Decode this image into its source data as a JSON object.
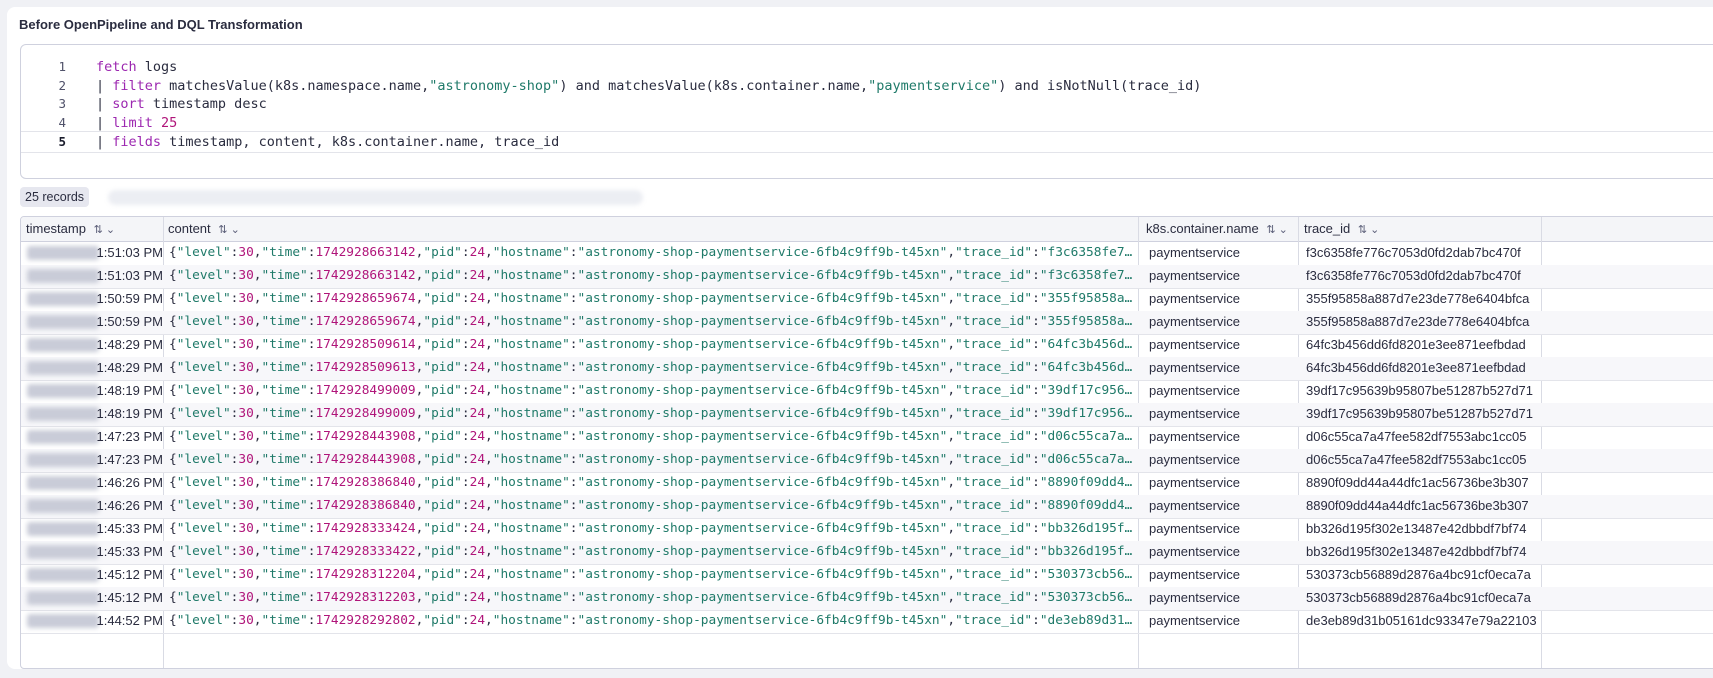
{
  "panel": {
    "title": "Before OpenPipeline and DQL Transformation"
  },
  "editor": {
    "lines": [
      {
        "num": "1",
        "segments": [
          [
            "kw",
            "fetch"
          ],
          [
            "plain",
            " logs"
          ]
        ]
      },
      {
        "num": "2",
        "segments": [
          [
            "plain",
            "| "
          ],
          [
            "kw",
            "filter"
          ],
          [
            "plain",
            " matchesValue(k8s.namespace.name,"
          ],
          [
            "str",
            "\"astronomy-shop\""
          ],
          [
            "plain",
            ") and matchesValue(k8s.container.name,"
          ],
          [
            "str",
            "\"paymentservice\""
          ],
          [
            "plain",
            ") and isNotNull(trace_id)"
          ]
        ]
      },
      {
        "num": "3",
        "segments": [
          [
            "plain",
            "| "
          ],
          [
            "kw",
            "sort"
          ],
          [
            "plain",
            " timestamp desc"
          ]
        ]
      },
      {
        "num": "4",
        "segments": [
          [
            "plain",
            "| "
          ],
          [
            "kw",
            "limit"
          ],
          [
            "plain",
            " "
          ],
          [
            "num",
            "25"
          ]
        ]
      },
      {
        "num": "5",
        "segments": [
          [
            "plain",
            "| "
          ],
          [
            "kw",
            "fields"
          ],
          [
            "plain",
            " timestamp, content, k8s.container.name, trace_id"
          ]
        ]
      }
    ]
  },
  "records": {
    "label": "25 records"
  },
  "table": {
    "columns": {
      "timestamp": "timestamp",
      "content": "content",
      "container": "k8s.container.name",
      "trace": "trace_id"
    },
    "icons": {
      "sort": "sort-icon",
      "menu": "chevron-down-icon"
    },
    "rows": [
      {
        "time": "1:51:03 PM",
        "ts": "1742928663142",
        "tid": "\"f3c6358fe7…",
        "container": "paymentservice",
        "trace": "f3c6358fe776c7053d0fd2dab7bc470f"
      },
      {
        "time": "1:51:03 PM",
        "ts": "1742928663142",
        "tid": "\"f3c6358fe7…",
        "container": "paymentservice",
        "trace": "f3c6358fe776c7053d0fd2dab7bc470f"
      },
      {
        "time": "1:50:59 PM",
        "ts": "1742928659674",
        "tid": "\"355f95858a…",
        "container": "paymentservice",
        "trace": "355f95858a887d7e23de778e6404bfca"
      },
      {
        "time": "1:50:59 PM",
        "ts": "1742928659674",
        "tid": "\"355f95858a…",
        "container": "paymentservice",
        "trace": "355f95858a887d7e23de778e6404bfca"
      },
      {
        "time": "1:48:29 PM",
        "ts": "1742928509614",
        "tid": "\"64fc3b456d…",
        "container": "paymentservice",
        "trace": "64fc3b456dd6fd8201e3ee871eefbdad"
      },
      {
        "time": "1:48:29 PM",
        "ts": "1742928509613",
        "tid": "\"64fc3b456d…",
        "container": "paymentservice",
        "trace": "64fc3b456dd6fd8201e3ee871eefbdad"
      },
      {
        "time": "1:48:19 PM",
        "ts": "1742928499009",
        "tid": "\"39df17c956…",
        "container": "paymentservice",
        "trace": "39df17c95639b95807be51287b527d71"
      },
      {
        "time": "1:48:19 PM",
        "ts": "1742928499009",
        "tid": "\"39df17c956…",
        "container": "paymentservice",
        "trace": "39df17c95639b95807be51287b527d71"
      },
      {
        "time": "1:47:23 PM",
        "ts": "1742928443908",
        "tid": "\"d06c55ca7a…",
        "container": "paymentservice",
        "trace": "d06c55ca7a47fee582df7553abc1cc05"
      },
      {
        "time": "1:47:23 PM",
        "ts": "1742928443908",
        "tid": "\"d06c55ca7a…",
        "container": "paymentservice",
        "trace": "d06c55ca7a47fee582df7553abc1cc05"
      },
      {
        "time": "1:46:26 PM",
        "ts": "1742928386840",
        "tid": "\"8890f09dd4…",
        "container": "paymentservice",
        "trace": "8890f09dd44a44dfc1ac56736be3b307"
      },
      {
        "time": "1:46:26 PM",
        "ts": "1742928386840",
        "tid": "\"8890f09dd4…",
        "container": "paymentservice",
        "trace": "8890f09dd44a44dfc1ac56736be3b307"
      },
      {
        "time": "1:45:33 PM",
        "ts": "1742928333424",
        "tid": "\"bb326d195f…",
        "container": "paymentservice",
        "trace": "bb326d195f302e13487e42dbbdf7bf74"
      },
      {
        "time": "1:45:33 PM",
        "ts": "1742928333422",
        "tid": "\"bb326d195f…",
        "container": "paymentservice",
        "trace": "bb326d195f302e13487e42dbbdf7bf74"
      },
      {
        "time": "1:45:12 PM",
        "ts": "1742928312204",
        "tid": "\"530373cb56…",
        "container": "paymentservice",
        "trace": "530373cb56889d2876a4bc91cf0eca7a"
      },
      {
        "time": "1:45:12 PM",
        "ts": "1742928312203",
        "tid": "\"530373cb56…",
        "container": "paymentservice",
        "trace": "530373cb56889d2876a4bc91cf0eca7a"
      },
      {
        "time": "1:44:52 PM",
        "ts": "1742928292802",
        "tid": "\"de3eb89d31…",
        "container": "paymentservice",
        "trace": "de3eb89d31b05161dc93347e79a22103"
      }
    ],
    "content_template": {
      "level_key": "\"level\"",
      "level_val": "30",
      "time_key": "\"time\"",
      "pid_key": "\"pid\"",
      "pid_val": "24",
      "host_key": "\"hostname\"",
      "host_val": "\"astronomy-shop-paymentservice-6fb4c9ff9b-t45xn\"",
      "trace_key": "\"trace_id\""
    }
  }
}
